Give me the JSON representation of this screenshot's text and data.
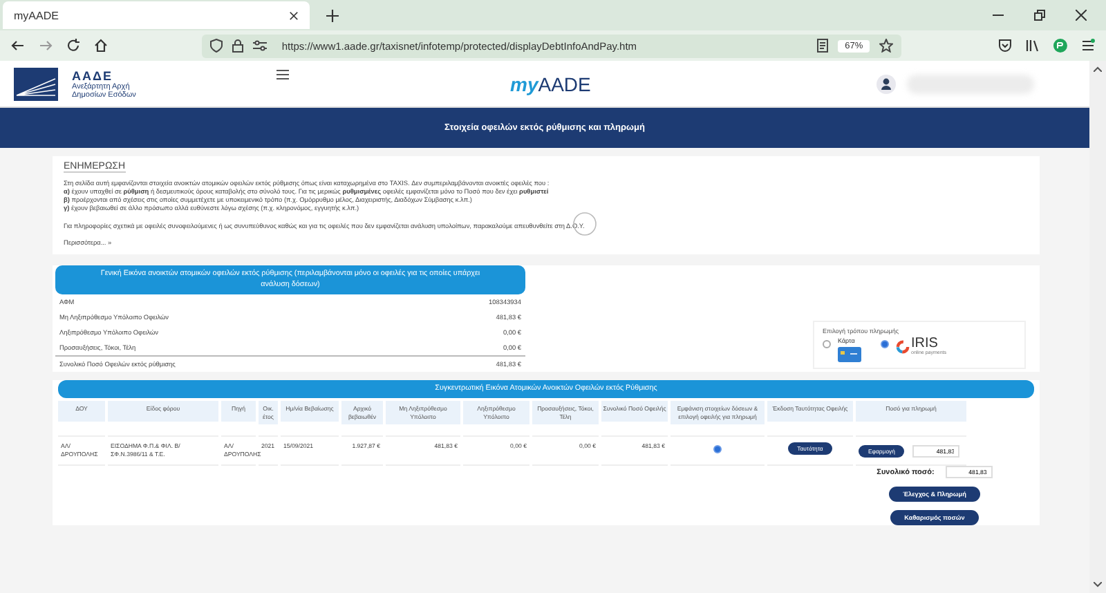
{
  "browser": {
    "tab_title": "myAADE",
    "url": "https://www1.aade.gr/taxisnet/infotemp/protected/displayDebtInfoAndPay.htm",
    "zoom": "67%"
  },
  "header": {
    "logo_title": "ΑΑΔΕ",
    "logo_subtitle": [
      "Ανεξάρτητη Αρχή",
      "Δημοσίων Εσόδων"
    ],
    "brand_prefix": "my",
    "brand_name": "AADE"
  },
  "page_title": "Στοιχεία οφειλών εκτός ρύθμισης και πληρωμή",
  "notice": {
    "heading": "ΕΝΗΜΕΡΩΣΗ",
    "paragraphs": [
      "Στη σελίδα αυτή εμφανίζονται στοιχεία ανοικτών ατομικών οφειλών εκτός ρύθμισης όπως είναι καταχωρημένα στο TAXIS. Δεν συμπεριλαμβάνονται ανοικτές οφειλές που :",
      "**α)** έχουν υπαχθεί σε **ρύθμιση** ή δεσμευτικούς όρους καταβολής στο σύνολό τους. Για τις μερικώς **ρυθμισμένες** οφειλές εμφανίζεται μόνο το Ποσό που δεν έχει **ρυθμιστεί**",
      "**β)** προέρχονται από σχέσεις στις οποίες συμμετέχετε με υποκειμενικό τρόπο (π.χ. Ομόρρυθμο μέλος, Διαχειριστής, Διαδόχων Σύμβασης κ.λπ.)",
      "**γ)** έχουν βεβαιωθεί σε άλλο πρόσωπο αλλά ευθύνεστε λόγω σχέσης (π.χ. κληρονόμος, εγγυητής κ.λπ.)"
    ],
    "footer": "Για πληροφορίες σχετικά με οφειλές συνοφειλούμενες ή ως συνυπεύθυνος καθώς και για τις οφειλές που δεν εμφανίζεται ανάλυση υπολοίπων, παρακαλούμε απευθυνθείτε στη Δ.Ο.Υ.",
    "more_link": "Περισσότερα... »"
  },
  "summary": {
    "title": "Γενική Εικόνα ανοικτών ατομικών οφειλών εκτός ρύθμισης (περιλαμβάνονται μόνο οι οφειλές για τις οποίες υπάρχει ανάλυση δόσεων)",
    "rows": [
      {
        "kind": "plain",
        "label": "ΑΦΜ",
        "value": "108343934"
      },
      {
        "kind": "plain",
        "label": "Μη Ληξιπρόθεσμο Υπόλοιπο Οφειλών",
        "value": "481,83 €"
      },
      {
        "kind": "plain",
        "label": "Ληξιπρόθεσμο Υπόλοιπο Οφειλών",
        "value": "0,00 €"
      },
      {
        "kind": "plain",
        "label": "Προσαυξήσεις, Τόκοι, Τέλη",
        "value": "0,00 €"
      },
      {
        "kind": "total",
        "label": "Συνολικό Ποσό Οφειλών εκτός ρύθμισης",
        "value": "481,83 €"
      }
    ]
  },
  "payment_method": {
    "label": "Επιλογή τρόπου πληρωμής",
    "options": [
      {
        "kind": "card",
        "label": "Κάρτα",
        "selected": false
      },
      {
        "kind": "iris",
        "label": "IRIS",
        "sublabel": "online payments",
        "selected": true
      }
    ]
  },
  "table": {
    "title": "Συγκεντρωτική Εικόνα Ατομικών Ανοικτών Οφειλών εκτός Ρύθμισης",
    "columns": [
      "ΔΟΥ",
      "Είδος φόρου",
      "Πηγή",
      "Οικ. έτος",
      "Ημ/νία Βεβαίωσης",
      "Αρχικό βεβαιωθέν",
      "Μη Ληξιπρόθεσμο Υπόλοιπο",
      "Ληξιπρόθεσμο Υπόλοιπο",
      "Προσαυξήσεις, Τόκοι, Τέλη",
      "Συνολικό Ποσό Οφειλής",
      "Εμφάνιση στοιχείων δόσεων & επιλογή οφειλής για πληρωμή",
      "Έκδοση Ταυτότητας Οφειλής",
      "Ποσό για πληρωμή"
    ],
    "rows": [
      {
        "cells": [
          "ΑΛ/ΔΡΟΥΠΟΛΗΣ",
          "ΕΙΣΟΔΗΜΑ Φ.Π.& ΦΙΛ. Β/ΣΦ.Ν.3986/11 & Τ.Ε.",
          "ΑΛ/ΔΡΟΥΠΟΛΗΣ",
          "2021",
          "15/09/2021",
          "1.927,87 €",
          "481,83 €",
          "0,00 €",
          "0,00 €",
          "481,83 €"
        ],
        "selected": true,
        "id_button": "Ταυτότητα",
        "apply_button": "Εφαρμογή",
        "amount": "481,83"
      }
    ],
    "total_label": "Συνολικό ποσό:",
    "total_value": "481,83",
    "buttons": [
      "Έλεγχος & Πληρωμή",
      "Καθαρισμός ποσών"
    ]
  }
}
